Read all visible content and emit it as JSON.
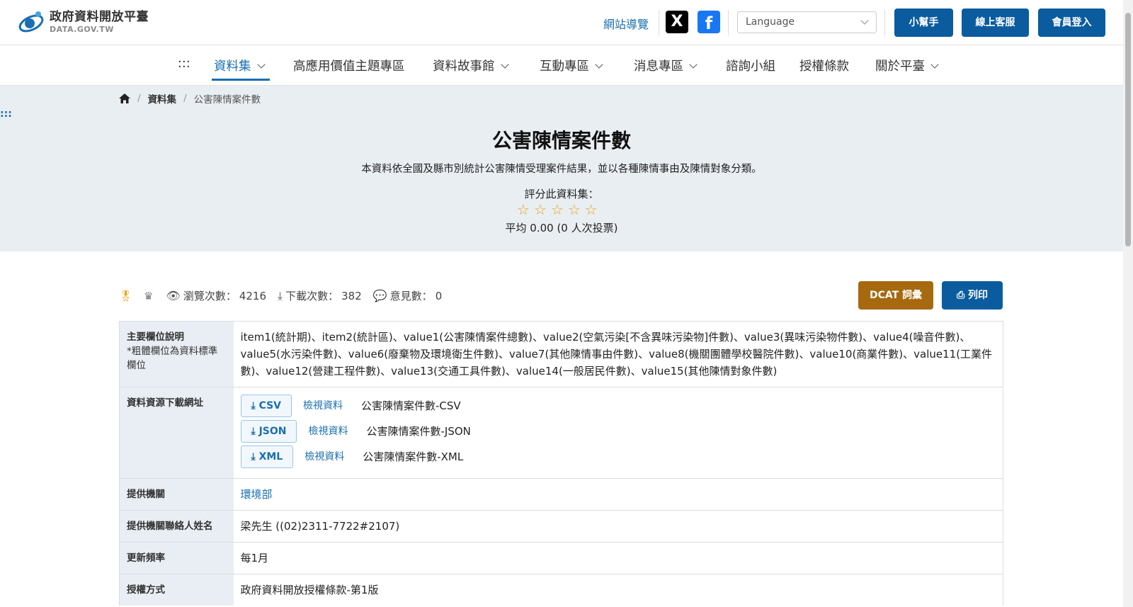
{
  "header": {
    "logo_title": "政府資料開放平臺",
    "logo_sub": "DATA.GOV.TW",
    "sitemap": "網站導覽",
    "social_x": "X",
    "social_fb": "f",
    "language_placeholder": "Language",
    "buttons": {
      "helper": "小幫手",
      "support": "線上客服",
      "login": "會員登入"
    }
  },
  "nav": {
    "menu_dots": ":::",
    "items": [
      "資料集",
      "高應用價值主題專區",
      "資料故事館",
      "互動專區",
      "消息專區",
      "諮詢小組",
      "授權條款",
      "關於平臺"
    ]
  },
  "breadcrumb": {
    "level1": "資料集",
    "current": "公害陳情案件數"
  },
  "hero": {
    "side_dots": ":::",
    "title": "公害陳情案件數",
    "description": "本資料依全國及縣市別統計公害陳情受理案件結果，並以各種陳情事由及陳情對象分類。",
    "rate_label": "評分此資料集：",
    "rating_value": 0,
    "rating_max": 5,
    "rate_avg": "平均 0.00 (0 人次投票)"
  },
  "stats": {
    "views_label": "瀏覽次數：",
    "views": "4216",
    "downloads_label": "下載次數：",
    "downloads": "382",
    "comments_label": "意見數：",
    "comments": "0",
    "dcat_button": "DCAT 詞彙",
    "print_button": "列印"
  },
  "details": {
    "fields_label": "主要欄位說明",
    "fields_note": "*粗體欄位為資料標準欄位",
    "fields_value": "item1(統計期)、item2(統計區)、value1(公害陳情案件總數)、value2(空氣污染[不含異味污染物]件數)、value3(異味污染物件數)、value4(噪音件數)、value5(水污染件數)、value6(廢棄物及環境衛生件數)、value7(其他陳情事由件數)、value8(機關團體學校醫院件數)、value10(商業件數)、value11(工業件數)、value12(營建工程件數)、value13(交通工具件數)、value14(一般居民件數)、value15(其他陳情對象件數)",
    "resources_label": "資料資源下載網址",
    "resources": [
      {
        "format": "CSV",
        "view": "檢視資料",
        "name": "公害陳情案件數-CSV"
      },
      {
        "format": "JSON",
        "view": "檢視資料",
        "name": "公害陳情案件數-JSON"
      },
      {
        "format": "XML",
        "view": "檢視資料",
        "name": "公害陳情案件數-XML"
      }
    ],
    "agency_label": "提供機關",
    "agency": "環境部",
    "contact_label": "提供機關聯絡人姓名",
    "contact": "梁先生 ((02)2311-7722#2107)",
    "frequency_label": "更新頻率",
    "frequency": "每1月",
    "license_label": "授權方式",
    "license": "政府資料開放授權條款-第1版"
  }
}
